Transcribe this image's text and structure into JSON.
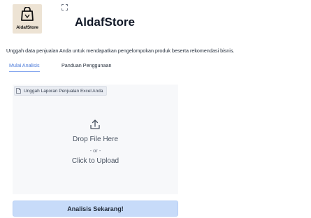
{
  "header": {
    "logo_text": "AldafStore",
    "title": "AldafStore"
  },
  "subtitle": "Unggah data penjualan Anda untuk mendapatkan pengelompokan produk beserta rekomendasi bisnis.",
  "tabs": [
    {
      "label": "Mulai Analisis",
      "active": true
    },
    {
      "label": "Panduan Penggunaan",
      "active": false
    }
  ],
  "upload": {
    "label": "Unggah Laporan Penjualan Excel Anda",
    "drop_text": "Drop File Here",
    "or_text": "- or -",
    "click_text": "Click to Upload"
  },
  "actions": {
    "analyze_label": "Analisis Sekarang!"
  },
  "colors": {
    "accent": "#4b7ad9",
    "button_bg": "#c7dbf9",
    "logo_bg": "#ede3d4"
  },
  "icons": [
    "shopping-bag-icon",
    "expand-icon",
    "file-icon",
    "upload-icon"
  ]
}
